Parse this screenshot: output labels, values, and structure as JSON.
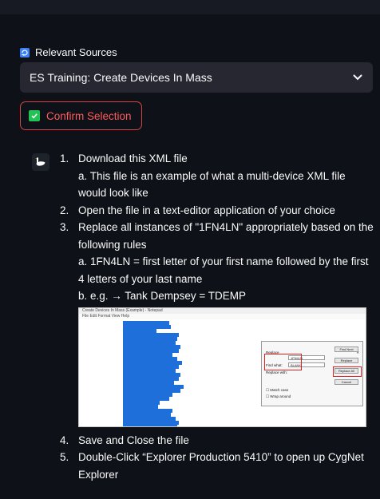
{
  "sources": {
    "label": "Relevant Sources",
    "selected": "ES Training: Create Devices In Mass"
  },
  "confirm": {
    "label": "Confirm Selection"
  },
  "steps": [
    {
      "num": "1.",
      "text": "Download this XML file"
    },
    {
      "sub": "a. This file is an example of what a multi-device XML file would look like"
    },
    {
      "num": "2.",
      "text": "Open the file in a text-editor application of your choice"
    },
    {
      "num": "3.",
      "text": "Replace all instances of \"1FN4LN\" appropriately based on the following rules"
    },
    {
      "sub": "a. 1FN4LN = first letter of your first name followed by the first 4 letters of your last name"
    },
    {
      "sub": "b. e.g. → Tank Dempsey = TDEMP"
    },
    {
      "num": "4.",
      "text": "Save and Close the file"
    },
    {
      "num": "5.",
      "text": "Double-Click “Explorer Production 5410” to open up CygNet Explorer"
    }
  ],
  "screenshot": {
    "window_title": "Create Devices In Mass (Example) - Notepad",
    "menu": "File   Edit   Format   View   Help",
    "dialog": {
      "title": "Replace",
      "find_label": "Find what:",
      "find_value": "1FN4LN",
      "replace_label": "Replace with:",
      "replace_value": "BLANK",
      "btn_find": "Find Next",
      "btn_replace": "Replace",
      "btn_replace_all": "Replace All",
      "btn_cancel": "Cancel",
      "match_case": "Match case",
      "wrap_around": "Wrap around"
    }
  }
}
